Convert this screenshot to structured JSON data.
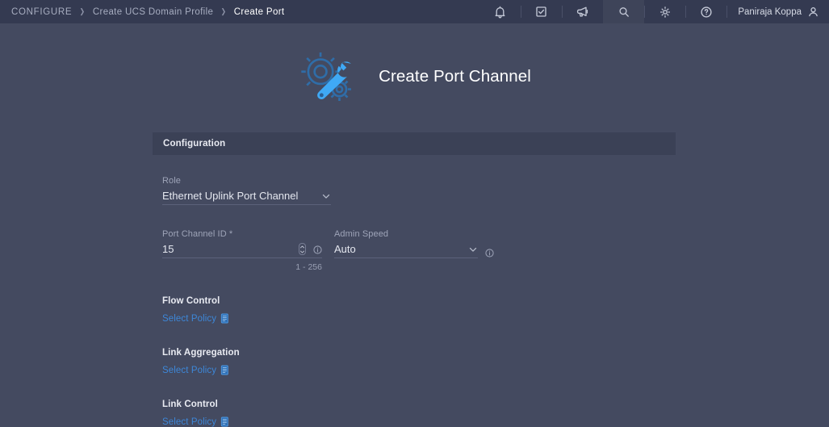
{
  "topbar": {
    "breadcrumb": [
      {
        "label": "CONFIGURE",
        "active": false
      },
      {
        "label": "Create UCS Domain Profile",
        "active": false
      },
      {
        "label": "Create Port",
        "active": true
      }
    ],
    "separator": "❯",
    "tools": [
      {
        "name": "bell-icon",
        "label": "Notifications"
      },
      {
        "name": "checklist-icon",
        "label": "Tasks"
      },
      {
        "name": "megaphone-icon",
        "label": "Announcements"
      },
      {
        "name": "search-icon",
        "label": "Search"
      },
      {
        "name": "gear-icon",
        "label": "Settings"
      },
      {
        "name": "help-icon",
        "label": "Help"
      }
    ],
    "user": {
      "name": "Paniraja Koppa",
      "icon": "user-icon"
    }
  },
  "hero": {
    "title": "Create Port Channel",
    "art_icon": "gears-wrench-illustration"
  },
  "panel": {
    "header": "Configuration",
    "role": {
      "label": "Role",
      "value": "Ethernet Uplink Port Channel",
      "chevron": "chevron-down-icon"
    },
    "port_channel_id": {
      "label": "Port Channel ID *",
      "value": "15",
      "hint": "1 - 256",
      "spinner": "number-stepper",
      "info": "info-icon"
    },
    "admin_speed": {
      "label": "Admin Speed",
      "value": "Auto",
      "chevron": "chevron-down-icon",
      "info": "info-icon"
    },
    "policies": [
      {
        "title": "Flow Control",
        "link": "Select Policy",
        "icon": "policy-document-icon"
      },
      {
        "title": "Link Aggregation",
        "link": "Select Policy",
        "icon": "policy-document-icon"
      },
      {
        "title": "Link Control",
        "link": "Select Policy",
        "icon": "policy-document-icon"
      }
    ]
  },
  "colors": {
    "page_bg": "#444a60",
    "topbar_bg": "#343a51",
    "panel_header_bg": "#3b4156",
    "accent_link": "#3d87d8",
    "accent_art": "#3fa9f5",
    "text_primary": "#ffffff",
    "text_muted": "#9ea4b8"
  }
}
